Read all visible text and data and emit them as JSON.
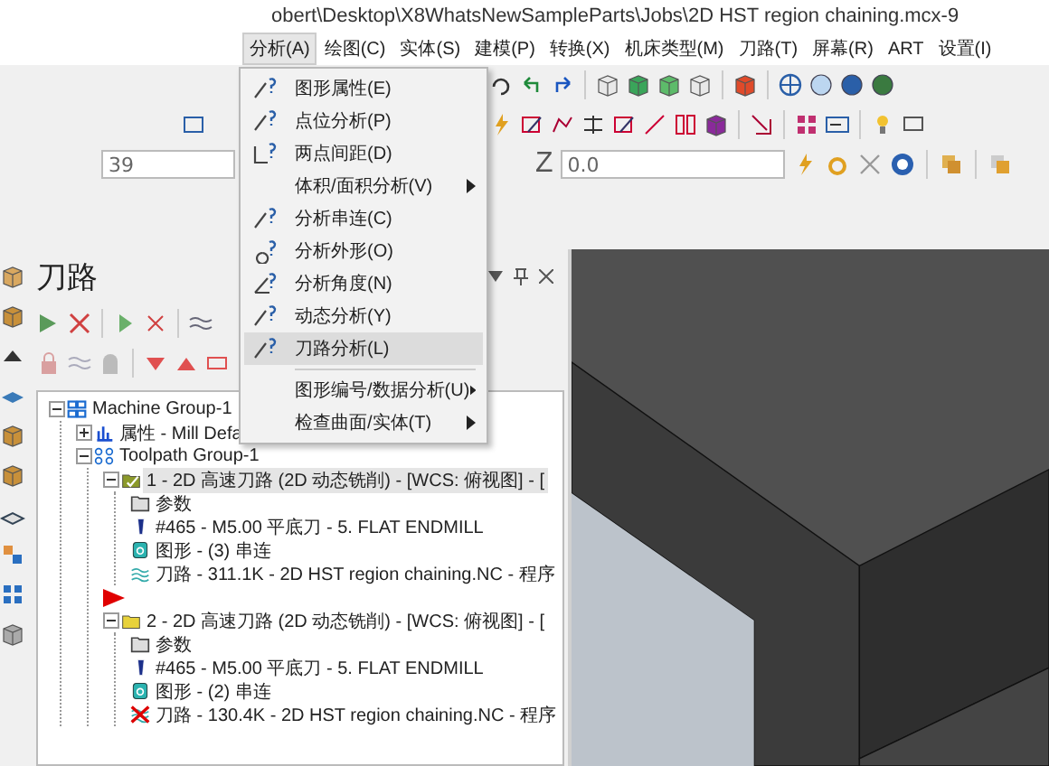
{
  "window": {
    "title": "obert\\Desktop\\X8WhatsNewSampleParts\\Jobs\\2D HST region chaining.mcx-9"
  },
  "menu_bar": [
    {
      "label": "分析(A)",
      "selected": true
    },
    {
      "label": "绘图(C)",
      "selected": false
    },
    {
      "label": "实体(S)",
      "selected": false
    },
    {
      "label": "建模(P)",
      "selected": false
    },
    {
      "label": "转换(X)",
      "selected": false
    },
    {
      "label": "机床类型(M)",
      "selected": false
    },
    {
      "label": "刀路(T)",
      "selected": false
    },
    {
      "label": "屏幕(R)",
      "selected": false
    },
    {
      "label": "ART",
      "selected": false
    },
    {
      "label": "设置(I)",
      "selected": false
    }
  ],
  "analysis_menu": [
    {
      "kind": "item",
      "label": "图形属性(E)",
      "submenu": false,
      "selected": false
    },
    {
      "kind": "item",
      "label": "点位分析(P)",
      "submenu": false,
      "selected": false
    },
    {
      "kind": "item",
      "label": "两点间距(D)",
      "submenu": false,
      "selected": false
    },
    {
      "kind": "item",
      "label": "体积/面积分析(V)",
      "submenu": true,
      "selected": false
    },
    {
      "kind": "item",
      "label": "分析串连(C)",
      "submenu": false,
      "selected": false
    },
    {
      "kind": "item",
      "label": "分析外形(O)",
      "submenu": false,
      "selected": false
    },
    {
      "kind": "item",
      "label": "分析角度(N)",
      "submenu": false,
      "selected": false
    },
    {
      "kind": "item",
      "label": "动态分析(Y)",
      "submenu": false,
      "selected": false
    },
    {
      "kind": "item",
      "label": "刀路分析(L)",
      "submenu": false,
      "selected": true
    },
    {
      "kind": "separator"
    },
    {
      "kind": "item",
      "label": "图形编号/数据分析(U)",
      "submenu": true,
      "selected": false
    },
    {
      "kind": "item",
      "label": "检查曲面/实体(T)",
      "submenu": true,
      "selected": false
    }
  ],
  "coordinates": {
    "field_1": {
      "value": "39"
    },
    "z": {
      "label": "Z",
      "value": "0.0"
    }
  },
  "toolpaths_panel": {
    "title": "刀路",
    "tree": [
      {
        "kind": "machine-group",
        "label": "Machine Group-1",
        "expanded": true,
        "children": [
          {
            "kind": "properties",
            "label": "属性 - Mill Defa",
            "expanded": false
          },
          {
            "kind": "toolpath-group",
            "label": "Toolpath Group-1",
            "expanded": true,
            "children": [
              {
                "kind": "operation",
                "label": "1 - 2D 高速刀路 (2D 动态铣削) - [WCS: 俯视图] - [",
                "expanded": true,
                "selected": true,
                "children": [
                  {
                    "kind": "params",
                    "label": "参数"
                  },
                  {
                    "kind": "tool",
                    "label": "#465 - M5.00 平底刀 - 5. FLAT ENDMILL"
                  },
                  {
                    "kind": "geometry",
                    "label": "图形 - (3) 串连"
                  },
                  {
                    "kind": "toolpath",
                    "label": "刀路 - 311.1K - 2D HST region chaining.NC - 程序",
                    "dirty": false
                  }
                ]
              },
              {
                "kind": "insert-marker"
              },
              {
                "kind": "operation",
                "label": "2 - 2D 高速刀路 (2D 动态铣削) - [WCS: 俯视图] - [",
                "expanded": true,
                "selected": false,
                "children": [
                  {
                    "kind": "params",
                    "label": "参数"
                  },
                  {
                    "kind": "tool",
                    "label": "#465 - M5.00 平底刀 - 5. FLAT ENDMILL"
                  },
                  {
                    "kind": "geometry",
                    "label": "图形 - (2) 串连"
                  },
                  {
                    "kind": "toolpath",
                    "label": "刀路 - 130.4K - 2D HST region chaining.NC - 程序",
                    "dirty": true
                  }
                ]
              }
            ]
          }
        ]
      }
    ]
  }
}
